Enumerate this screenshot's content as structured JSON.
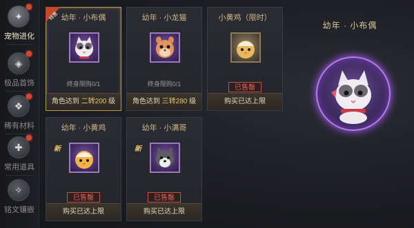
{
  "sidebar": {
    "items": [
      {
        "label": "宠物进化",
        "icon": "pet-badge-icon",
        "active": true,
        "dot": true
      },
      {
        "label": "极品首饰",
        "icon": "jewelry-icon",
        "active": false,
        "dot": true
      },
      {
        "label": "稀有材料",
        "icon": "material-icon",
        "active": false,
        "dot": true
      },
      {
        "label": "常用道具",
        "icon": "item-bag-icon",
        "active": false,
        "dot": true
      },
      {
        "label": "铭文镶嵌",
        "icon": "inscription-icon",
        "active": false,
        "dot": false
      }
    ]
  },
  "cards": [
    {
      "title": "幼年 · 小布偶",
      "tag": "特惠",
      "limit": "终身限购0/1",
      "footer_prefix": "角色达到 ",
      "footer_highlight": "二转200",
      "footer_suffix": " 级",
      "pet": "ragdoll-cat"
    },
    {
      "title": "幼年 · 小龙猫",
      "limit": "终身限购0/1",
      "footer_prefix": "角色达到 ",
      "footer_highlight": "三转280",
      "footer_suffix": " 级",
      "pet": "chinchilla"
    },
    {
      "title": "小黄鸡（限时）",
      "status": "已售罄",
      "footer": "购买已达上限",
      "pet": "yellow-chick"
    },
    {
      "title": "幼年 · 小黄鸡",
      "new": "新",
      "status": "已售罄",
      "footer": "购买已达上限",
      "pet": "yellow-chick"
    },
    {
      "title": "幼年 · 小满哥",
      "new": "新",
      "status": "已售罄",
      "footer": "购买已达上限",
      "pet": "husky-dog"
    }
  ],
  "preview": {
    "title": "幼年 · 小布偶",
    "pet": "ragdoll-cat"
  },
  "colors": {
    "gold": "#e9c66e",
    "soldout": "#e0604a",
    "purple_glow": "#b27fe8"
  }
}
